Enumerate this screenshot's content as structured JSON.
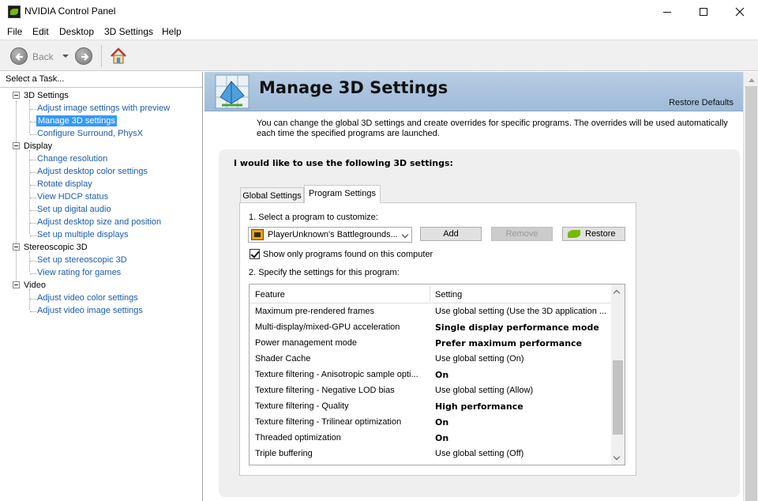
{
  "window": {
    "title": "NVIDIA Control Panel"
  },
  "menu": [
    "File",
    "Edit",
    "Desktop",
    "3D Settings",
    "Help"
  ],
  "toolbar": {
    "back_label": "Back"
  },
  "left_pane": {
    "header": "Select a Task...",
    "categories": [
      {
        "label": "3D Settings",
        "items": [
          "Adjust image settings with preview",
          "Manage 3D settings",
          "Configure Surround, PhysX"
        ]
      },
      {
        "label": "Display",
        "items": [
          "Change resolution",
          "Adjust desktop color settings",
          "Rotate display",
          "View HDCP status",
          "Set up digital audio",
          "Adjust desktop size and position",
          "Set up multiple displays"
        ]
      },
      {
        "label": "Stereoscopic 3D",
        "items": [
          "Set up stereoscopic 3D",
          "View rating for games"
        ]
      },
      {
        "label": "Video",
        "items": [
          "Adjust video color settings",
          "Adjust video image settings"
        ]
      }
    ],
    "selected": "Manage 3D settings"
  },
  "page": {
    "title": "Manage 3D Settings",
    "restore_defaults": "Restore Defaults",
    "description": "You can change the global 3D settings and create overrides for specific programs. The overrides will be used automatically each time the specified programs are launched.",
    "section_heading": "I would like to use the following 3D settings:",
    "tabs": [
      "Global Settings",
      "Program Settings"
    ],
    "active_tab": "Program Settings",
    "step1_label": "1. Select a program to customize:",
    "selected_program": "PlayerUnknown's Battlegrounds...",
    "buttons": {
      "add": "Add",
      "remove": "Remove",
      "restore": "Restore"
    },
    "show_only_label": "Show only programs found on this computer",
    "show_only_checked": true,
    "step2_label": "2. Specify the settings for this program:",
    "grid_headers": {
      "feature": "Feature",
      "setting": "Setting"
    },
    "rows": [
      {
        "feature": "Maximum pre-rendered frames",
        "setting": "Use global setting (Use the 3D application ...",
        "bold": false
      },
      {
        "feature": "Multi-display/mixed-GPU acceleration",
        "setting": "Single display performance mode",
        "bold": true
      },
      {
        "feature": "Power management mode",
        "setting": "Prefer maximum performance",
        "bold": true
      },
      {
        "feature": "Shader Cache",
        "setting": "Use global setting (On)",
        "bold": false
      },
      {
        "feature": "Texture filtering - Anisotropic sample opti...",
        "setting": "On",
        "bold": true
      },
      {
        "feature": "Texture filtering - Negative LOD bias",
        "setting": "Use global setting (Allow)",
        "bold": false
      },
      {
        "feature": "Texture filtering - Quality",
        "setting": "High performance",
        "bold": true
      },
      {
        "feature": "Texture filtering - Trilinear optimization",
        "setting": "On",
        "bold": true
      },
      {
        "feature": "Threaded optimization",
        "setting": "On",
        "bold": true
      },
      {
        "feature": "Triple buffering",
        "setting": "Use global setting (Off)",
        "bold": false
      }
    ]
  },
  "colors": {
    "link": "#1a5bb0",
    "selection": "#3399ff",
    "banner": "#a8c2de",
    "nvidia_green": "#76b900"
  }
}
